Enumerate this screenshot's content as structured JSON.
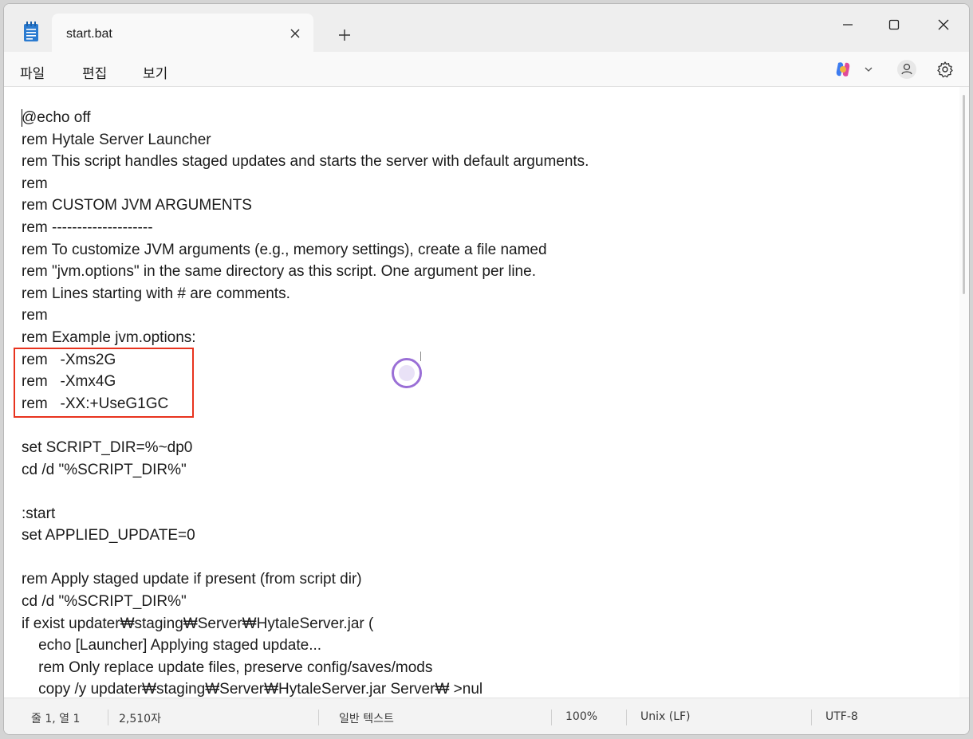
{
  "titlebar": {
    "tab_title": "start.bat"
  },
  "menu": {
    "items": [
      "파일",
      "편집",
      "보기"
    ]
  },
  "editor": {
    "lines": [
      "@echo off",
      "rem Hytale Server Launcher",
      "rem This script handles staged updates and starts the server with default arguments.",
      "rem",
      "rem CUSTOM JVM ARGUMENTS",
      "rem --------------------",
      "rem To customize JVM arguments (e.g., memory settings), create a file named",
      "rem \"jvm.options\" in the same directory as this script. One argument per line.",
      "rem Lines starting with # are comments.",
      "rem",
      "rem Example jvm.options:",
      "rem   -Xms2G",
      "rem   -Xmx4G",
      "rem   -XX:+UseG1GC",
      "",
      "set SCRIPT_DIR=%~dp0",
      "cd /d \"%SCRIPT_DIR%\"",
      "",
      ":start",
      "set APPLIED_UPDATE=0",
      "",
      "rem Apply staged update if present (from script dir)",
      "cd /d \"%SCRIPT_DIR%\"",
      "if exist updater₩staging₩Server₩HytaleServer.jar (",
      "    echo [Launcher] Applying staged update...",
      "    rem Only replace update files, preserve config/saves/mods",
      "    copy /y updater₩staging₩Server₩HytaleServer.jar Server₩ >nul"
    ]
  },
  "statusbar": {
    "position": "줄 1, 열 1",
    "char_count": "2,510자",
    "text_type": "일반 텍스트",
    "zoom": "100%",
    "line_ending": "Unix (LF)",
    "encoding": "UTF-8"
  },
  "colors": {
    "highlight_box": "#e8331e",
    "cursor_ring": "#9a6fd6",
    "app_icon": "#2b7bd0"
  }
}
